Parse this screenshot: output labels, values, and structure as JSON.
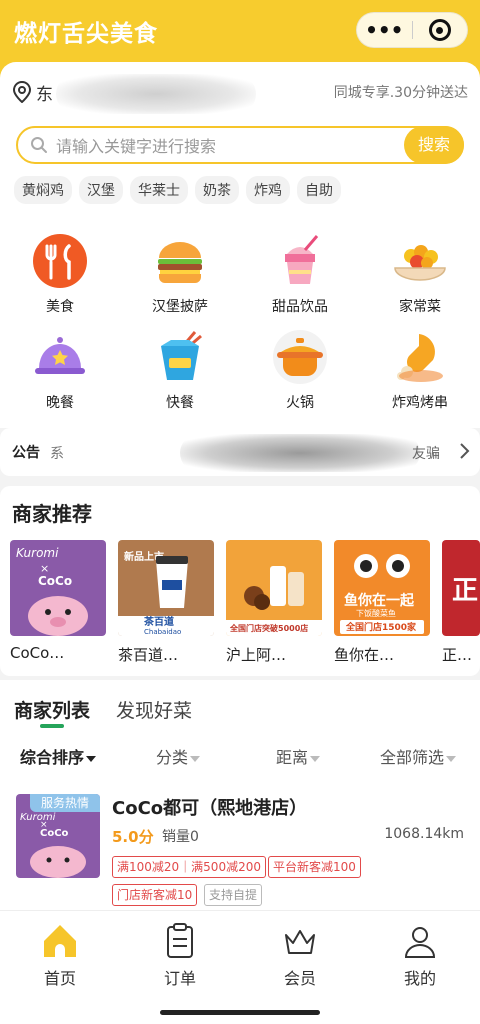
{
  "header": {
    "app_title": "燃灯舌尖美食",
    "capsule": {
      "more_label": "•••"
    }
  },
  "location": {
    "address_visible": "东",
    "delivery_note": "同城专享.30分钟送达"
  },
  "search": {
    "placeholder": "请输入关键字进行搜索",
    "button_label": "搜索"
  },
  "hot_tags": [
    "黄焖鸡",
    "汉堡",
    "华莱士",
    "奶茶",
    "炸鸡",
    "自助"
  ],
  "categories": [
    {
      "label": "美食",
      "icon": "cutlery-icon"
    },
    {
      "label": "汉堡披萨",
      "icon": "burger-icon"
    },
    {
      "label": "甜品饮品",
      "icon": "dessert-drink-icon"
    },
    {
      "label": "家常菜",
      "icon": "home-dish-icon"
    },
    {
      "label": "晚餐",
      "icon": "dinner-cloche-icon"
    },
    {
      "label": "快餐",
      "icon": "takeout-box-icon"
    },
    {
      "label": "火锅",
      "icon": "hotpot-icon"
    },
    {
      "label": "炸鸡烤串",
      "icon": "chicken-leg-icon"
    }
  ],
  "notice": {
    "label": "公告",
    "text_start": "系",
    "text_end": "友骗"
  },
  "recommend": {
    "title": "商家推荐",
    "shops": [
      {
        "name": "CoCo…",
        "image_text": [
          "Kuromi",
          "×",
          "CoCo"
        ]
      },
      {
        "name": "茶百道…",
        "image_text": [
          "茶百道",
          "Chabaidao",
          "新品上市"
        ]
      },
      {
        "name": "沪上阿…",
        "image_text": [
          "全国门店突破5000店"
        ]
      },
      {
        "name": "鱼你在…",
        "image_text": [
          "鱼你在一起",
          "下饭酸菜鱼",
          "全国门店1500家"
        ]
      },
      {
        "name": "正…",
        "image_text": [
          "正"
        ]
      }
    ]
  },
  "list": {
    "tabs": [
      {
        "label": "商家列表",
        "active": true
      },
      {
        "label": "发现好菜",
        "active": false
      }
    ],
    "sort": [
      "综合排序",
      "分类",
      "距离",
      "全部筛选"
    ],
    "merchants": [
      {
        "badge": "服务热情",
        "name": "CoCo都可（熙地港店）",
        "score": "5.0分",
        "sales": "销量0",
        "distance": "1068.14km",
        "coupons": [
          "满100减20｜满500减200",
          "平台新客减100",
          "门店新客减10"
        ],
        "support": "支持自提",
        "image_text": [
          "Kuromi",
          "×",
          "CoCo"
        ]
      }
    ]
  },
  "tabbar": [
    {
      "label": "首页",
      "icon": "home-icon",
      "active": true
    },
    {
      "label": "订单",
      "icon": "order-clipboard-icon",
      "active": false
    },
    {
      "label": "会员",
      "icon": "crown-icon",
      "active": false
    },
    {
      "label": "我的",
      "icon": "user-icon",
      "active": false
    }
  ],
  "colors": {
    "brand_yellow": "#f6c52a",
    "accent_green": "#25a45a",
    "coupon_red": "#e24a4a",
    "score_orange": "#f39a1c",
    "kuromi_purple": "#8a5aa8"
  }
}
